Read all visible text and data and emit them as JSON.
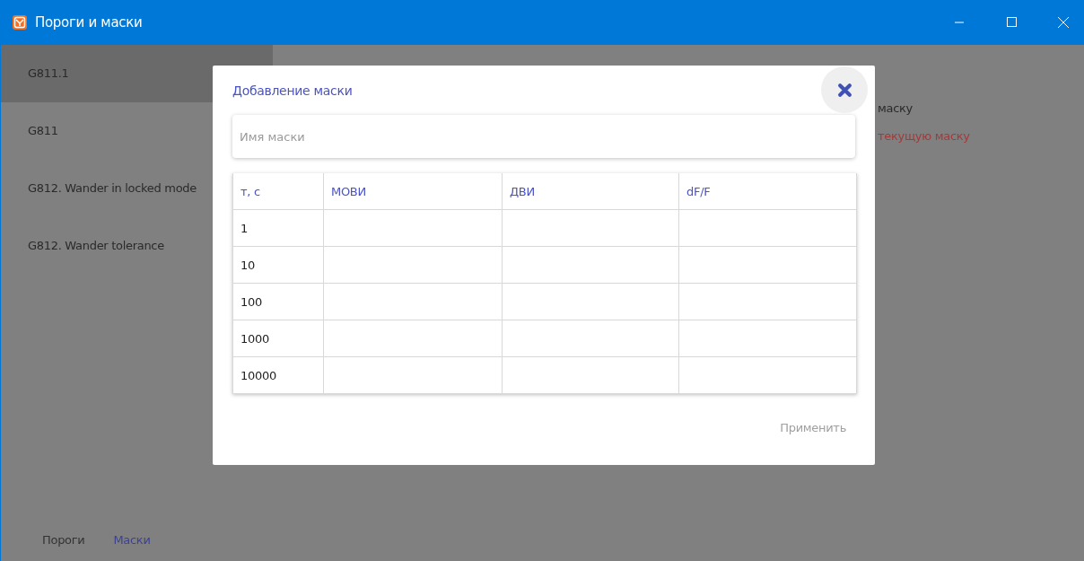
{
  "window": {
    "title": "Пороги и маски"
  },
  "sidebar": {
    "items": [
      {
        "label": "G811.1",
        "selected": true
      },
      {
        "label": "G811",
        "selected": false
      },
      {
        "label": "G812. Wander in locked mode",
        "selected": false
      },
      {
        "label": "G812. Wander tolerance",
        "selected": false
      }
    ]
  },
  "background_texts": [
    {
      "text": "маску",
      "kind": "normal"
    },
    {
      "text": "текущую маску",
      "kind": "danger"
    }
  ],
  "bottom_tabs": [
    {
      "label": "Пороги",
      "selected": false
    },
    {
      "label": "Маски",
      "selected": true
    }
  ],
  "dialog": {
    "title": "Добавление маски",
    "name_field": {
      "placeholder": "Имя маски"
    },
    "table": {
      "columns": [
        "т, с",
        "МОВИ",
        "ДВИ",
        "dF/F"
      ],
      "rows": [
        [
          "1",
          "",
          "",
          ""
        ],
        [
          "10",
          "",
          "",
          ""
        ],
        [
          "100",
          "",
          "",
          ""
        ],
        [
          "1000",
          "",
          "",
          ""
        ],
        [
          "10000",
          "",
          "",
          ""
        ]
      ]
    },
    "apply_button": {
      "label": "Применить",
      "disabled": true
    }
  }
}
